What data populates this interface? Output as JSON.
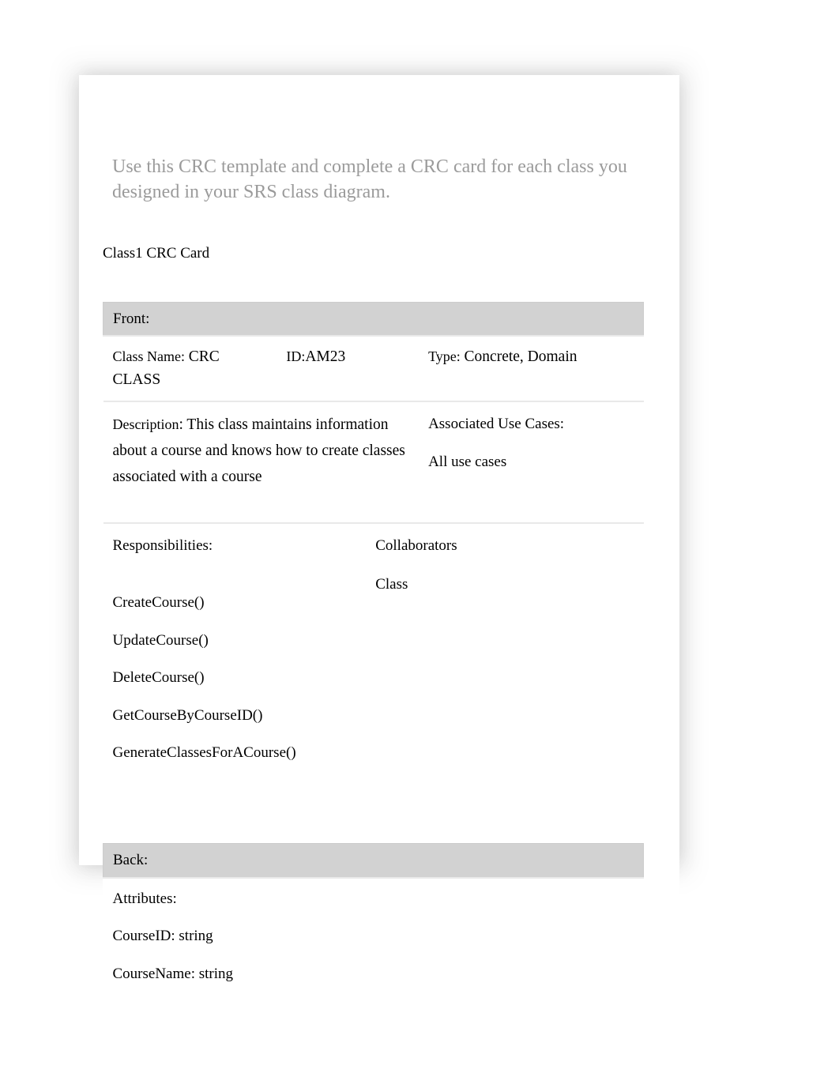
{
  "instruction": "Use this CRC template and complete a CRC card for each class you designed in your SRS class diagram.",
  "card_title": "Class1 CRC Card",
  "front": {
    "header": "Front:",
    "class_name_label": "Class Name:",
    "class_name_value": "CRC CLASS",
    "id_label": "ID:",
    "id_value": "AM23",
    "type_label": "Type:",
    "type_value": "Concrete, Domain",
    "description_label": "Description",
    "description_value": ": This class maintains information about a course and knows how to create classes associated with a course",
    "associated_use_cases_label": "Associated Use Cases:",
    "associated_use_cases_value": "All use cases",
    "responsibilities_label": "Responsibilities:",
    "responsibilities": [
      "CreateCourse()",
      "UpdateCourse()",
      "DeleteCourse()",
      "GetCourseByCourseID()",
      "GenerateClassesForACourse()"
    ],
    "collaborators_label": "Collaborators",
    "collaborators_value": "Class"
  },
  "back": {
    "header": "Back:",
    "attributes_label": "Attributes:",
    "attributes": [
      "CourseID: string",
      "CourseName: string"
    ]
  }
}
